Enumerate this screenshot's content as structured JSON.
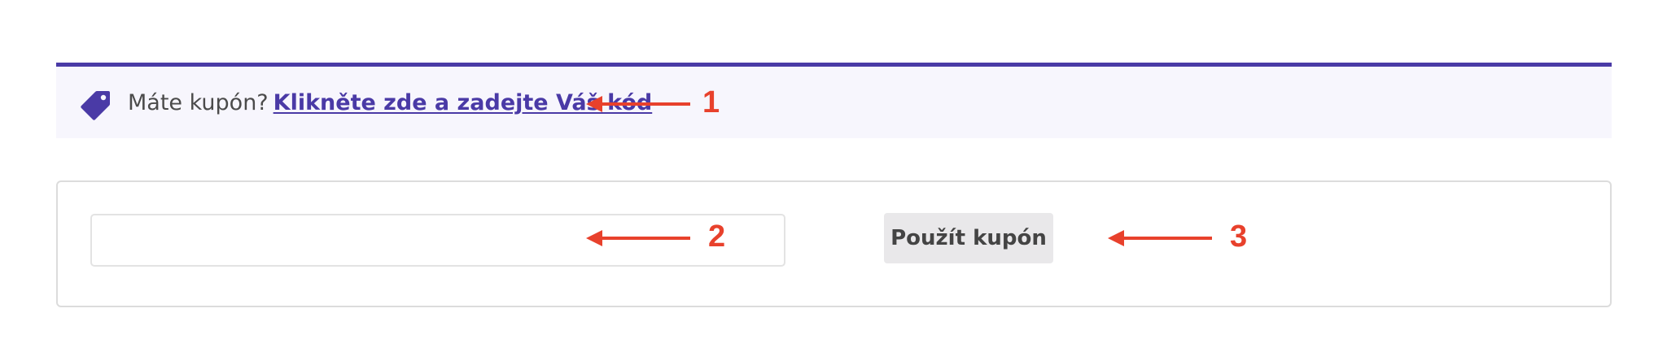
{
  "notice": {
    "prefix": "Máte kupón?",
    "link_text": "Klikněte zde a zadejte Váš kód",
    "icon": "tag-icon",
    "accent_color": "#4a3aa6",
    "background_color": "#f7f6fd"
  },
  "form": {
    "coupon_input": {
      "value": "",
      "placeholder": ""
    },
    "apply_button_label": "Použít kupón"
  },
  "annotations": {
    "color": "#e8412c",
    "items": [
      {
        "number": "1"
      },
      {
        "number": "2"
      },
      {
        "number": "3"
      }
    ]
  }
}
